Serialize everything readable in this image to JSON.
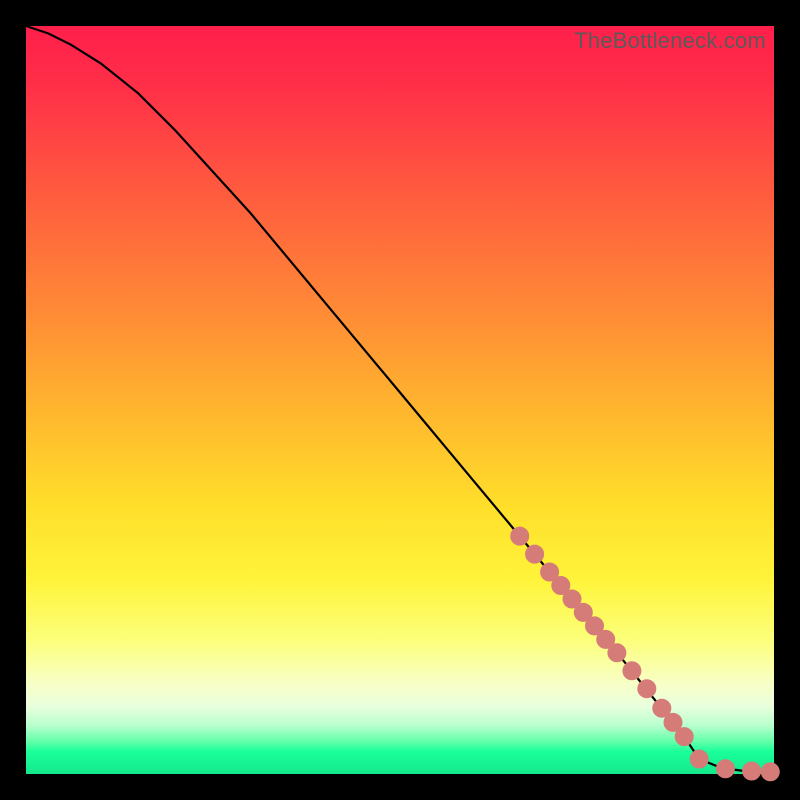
{
  "watermark": "TheBottleneck.com",
  "colors": {
    "curve_stroke": "#000000",
    "marker_fill": "#d67c78",
    "marker_stroke": "#d67c78"
  },
  "chart_data": {
    "type": "line",
    "title": "",
    "xlabel": "",
    "ylabel": "",
    "xlim": [
      0,
      100
    ],
    "ylim": [
      0,
      100
    ],
    "series": [
      {
        "name": "bottleneck-curve",
        "x": [
          0,
          3,
          6,
          10,
          15,
          20,
          30,
          40,
          50,
          60,
          70,
          80,
          88,
          90,
          93,
          96,
          100
        ],
        "y": [
          100,
          99,
          97.5,
          95,
          91,
          86,
          75,
          63,
          51,
          39,
          27,
          15,
          5,
          2,
          0.8,
          0.4,
          0.3
        ]
      }
    ],
    "markers": [
      {
        "x": 66,
        "y": 31.8
      },
      {
        "x": 68,
        "y": 29.4
      },
      {
        "x": 70,
        "y": 27.0
      },
      {
        "x": 71.5,
        "y": 25.2
      },
      {
        "x": 73,
        "y": 23.4
      },
      {
        "x": 74.5,
        "y": 21.6
      },
      {
        "x": 76,
        "y": 19.8
      },
      {
        "x": 77.5,
        "y": 18.0
      },
      {
        "x": 79,
        "y": 16.2
      },
      {
        "x": 81,
        "y": 13.8
      },
      {
        "x": 83,
        "y": 11.4
      },
      {
        "x": 85,
        "y": 8.8
      },
      {
        "x": 86.5,
        "y": 6.9
      },
      {
        "x": 88,
        "y": 5.0
      },
      {
        "x": 90,
        "y": 2.0
      },
      {
        "x": 93.5,
        "y": 0.7
      },
      {
        "x": 97,
        "y": 0.4
      },
      {
        "x": 99.5,
        "y": 0.3
      }
    ]
  }
}
